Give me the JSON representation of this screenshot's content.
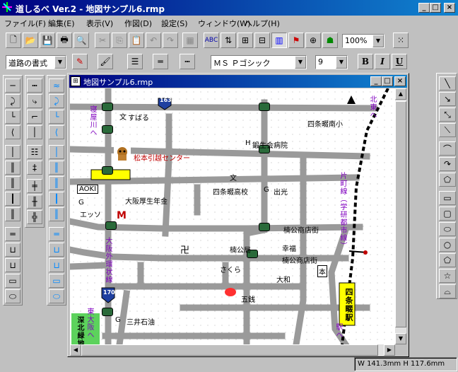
{
  "window": {
    "title": "道しるべ Ver.2 - 地図サンプル6.rmp",
    "min": "_",
    "max": "□",
    "close": "×"
  },
  "menu": [
    "ファイル(F)",
    "編集(E)",
    "表示(V)",
    "作図(D)",
    "設定(S)",
    "ウィンドウ(W)",
    "ヘルプ(H)"
  ],
  "toolbar": {
    "abc_label": "ABC",
    "zoom": "100%"
  },
  "format": {
    "road_style": "道路の書式",
    "font": "ＭＳ Ｐゴシック",
    "size": "9",
    "bold": "B",
    "italic": "I",
    "underline": "U"
  },
  "child": {
    "title": "地図サンプル6.rmp",
    "min": "_",
    "max": "□",
    "close": "×"
  },
  "map": {
    "labels": {
      "subaru": "すばる",
      "kaji": "鍛生会病院",
      "matsumoto": "松本引越センター",
      "shijo_minami": "四条畷南小",
      "shijo_high": "四条畷高校",
      "idemitsu": "出光",
      "aoki": "AOKI",
      "esso": "エッソ",
      "osaka_kosei": "大阪厚生年金",
      "kusu_street1": "楠公商店街",
      "kusu_street2": "楠公商店街",
      "kusu_park": "楠公局",
      "kofuku": "幸福",
      "sakura": "さくら",
      "daiwa": "大和",
      "goitsu": "五銭",
      "mitsui": "三井石油",
      "kanji_man": "卍",
      "station": "四条畷駅",
      "kouhon": "本"
    },
    "vertical": {
      "gushikawa": "寝屋川へ",
      "kitayama": "北東へ",
      "katamachi": "片町線（学研都市線）",
      "gaikan": "大阪外環状線",
      "higashiosaka": "東大阪へ",
      "fukakita": "深北緑地",
      "eki": "駅へ"
    },
    "route_a": "163",
    "route_b": "170",
    "gas_sym": "G",
    "school_sym": "文",
    "hosp_sym": "H"
  },
  "status": {
    "size": "W 141.3mm  H 117.6mm"
  }
}
